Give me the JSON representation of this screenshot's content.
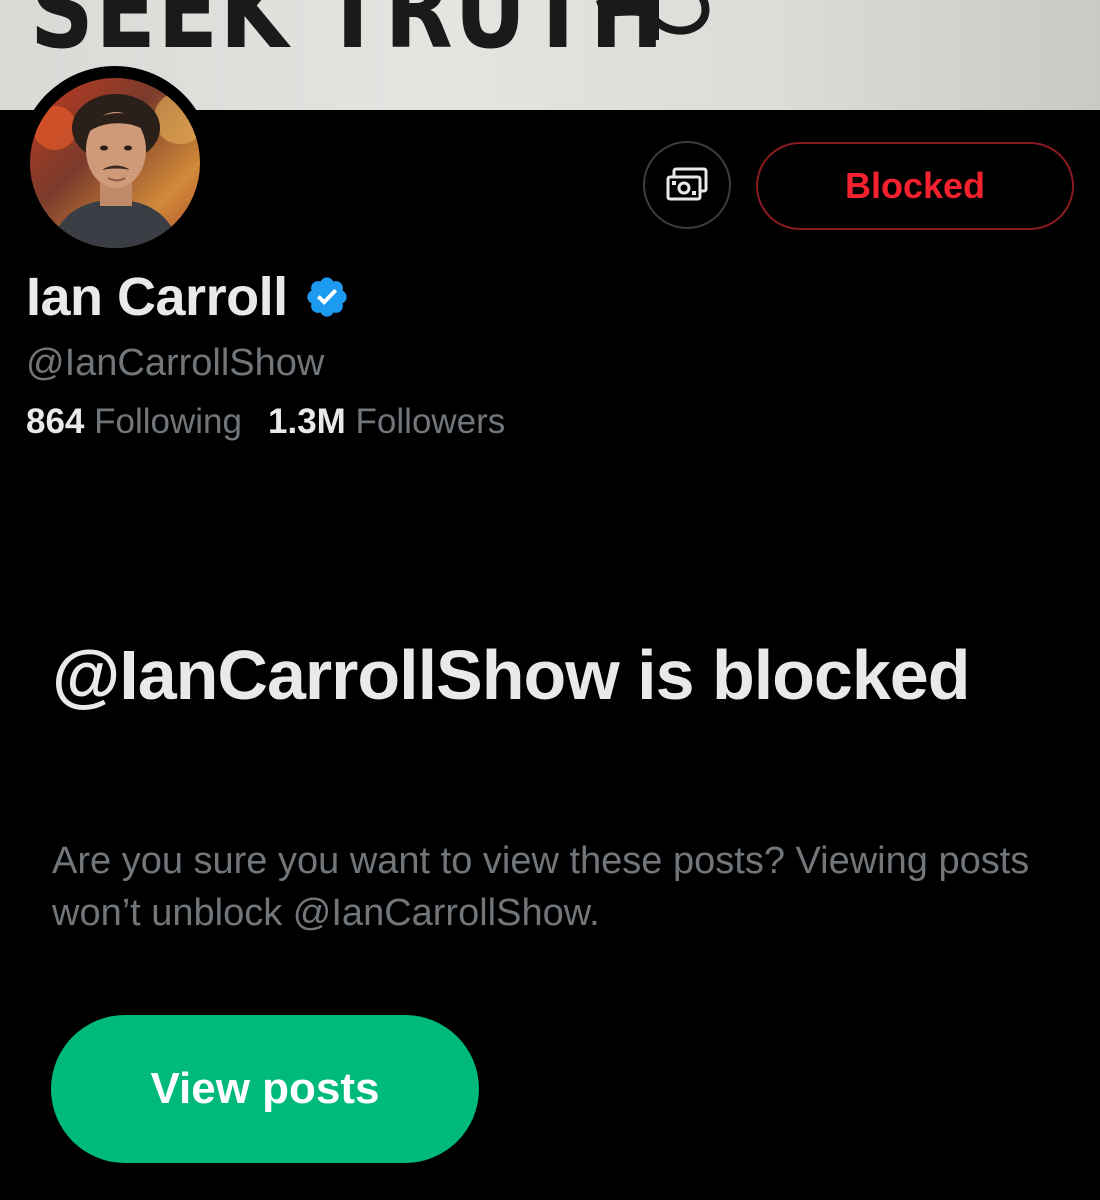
{
  "banner": {
    "text": "SEEK TRUTH"
  },
  "profile": {
    "display_name": "Ian Carroll",
    "handle": "@IanCarrollShow",
    "verified": true,
    "following_count": "864",
    "following_label": "Following",
    "followers_count": "1.3M",
    "followers_label": "Followers"
  },
  "actions": {
    "tip_icon": "money-icon",
    "blocked_label": "Blocked"
  },
  "blocked_notice": {
    "title": "@IanCarrollShow is blocked",
    "description": "Are you sure you want to view these posts? Viewing posts won’t unblock @IanCarrollShow.",
    "button_label": "View posts"
  },
  "colors": {
    "background": "#000000",
    "primary_text": "#e7e9ea",
    "secondary_text": "#71767b",
    "blocked_red": "#f4212e",
    "verified_blue": "#1d9bf0",
    "view_posts_green": "#00ba7c"
  }
}
